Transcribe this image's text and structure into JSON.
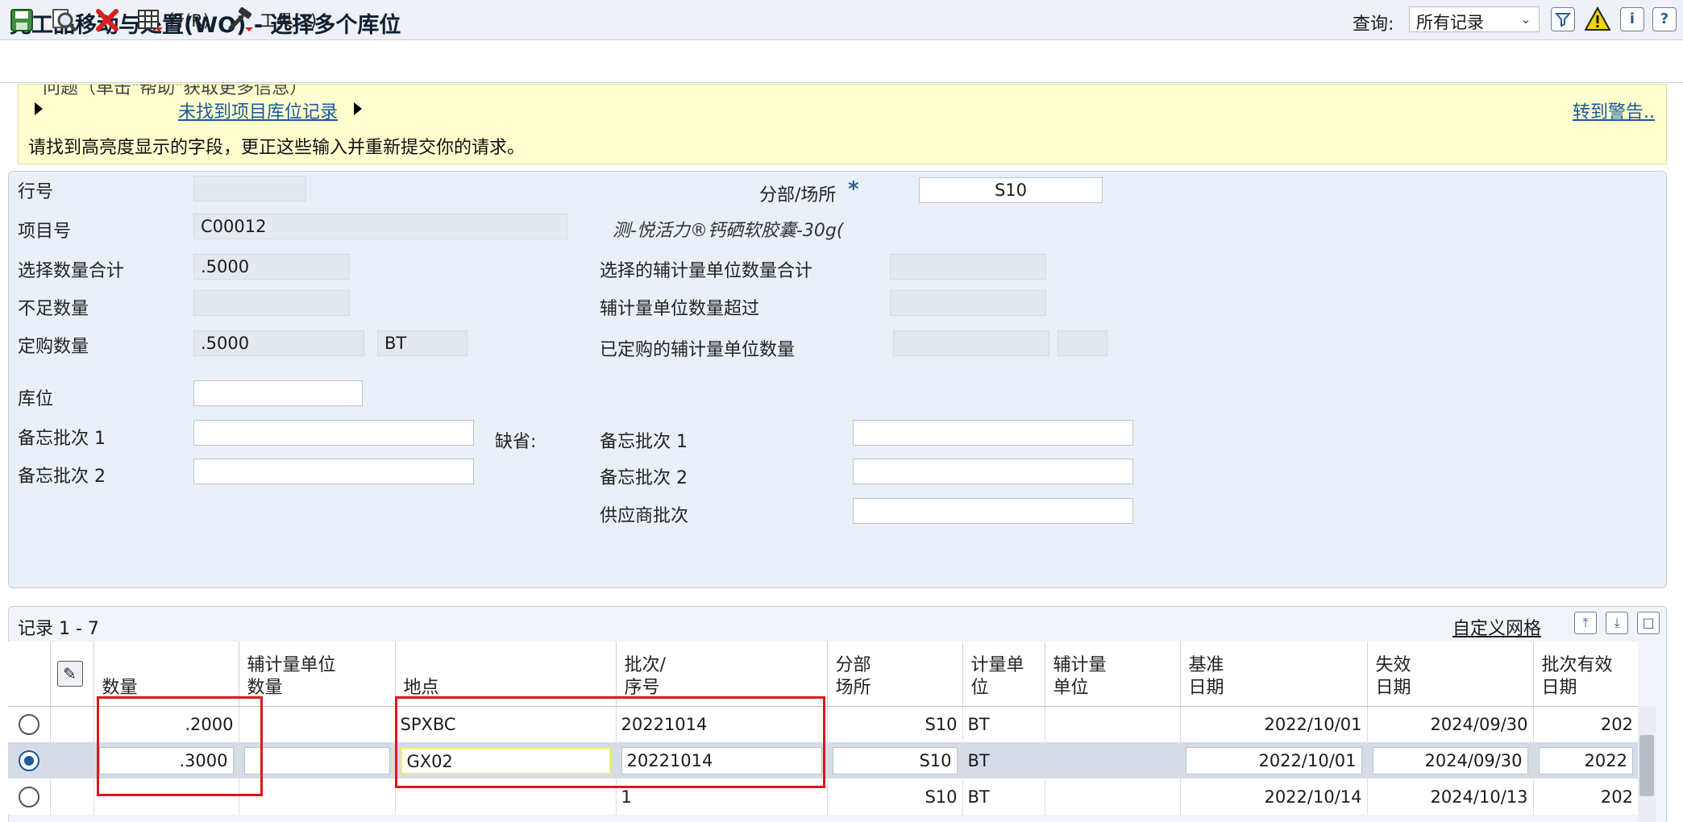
{
  "header": {
    "title": "完工品移动与处置(WO) - 选择多个库位",
    "query_label": "查询:",
    "query_value": "所有记录"
  },
  "toolbar": {
    "row_label": "行(R)",
    "tools_label": "工具(T)"
  },
  "banner": {
    "cut_text": "问题（单击\"帮助\"获取更多信息）",
    "error_link": "未找到项目库位记录",
    "goto_warnings": "转到警告..",
    "message": "请找到高亮度显示的字段，更正这些输入并重新提交你的请求。"
  },
  "form": {
    "line_no_label": "行号",
    "line_no_value": "",
    "branch_label": "分部/场所",
    "branch_value": "S10",
    "item_label": "项目号",
    "item_value": "C00012",
    "item_desc": "测-悦活力®钙硒软胶囊-30g(",
    "sel_qty_label": "选择数量合计",
    "sel_qty_value": ".5000",
    "sel_sec_label": "选择的辅计量单位数量合计",
    "sel_sec_value": "",
    "short_qty_label": "不足数量",
    "short_qty_value": "",
    "sec_over_label": "辅计量单位数量超过",
    "sec_over_value": "",
    "order_qty_label": "定购数量",
    "order_qty_value": ".5000",
    "order_uom_value": "BT",
    "ordered_sec_label": "已定购的辅计量单位数量",
    "location_label": "库位",
    "location_value": "",
    "memo1_label": "备忘批次 1",
    "memo2_label": "备忘批次 2",
    "default_label": "缺省:",
    "def_memo1_label": "备忘批次 1",
    "def_memo2_label": "备忘批次 2",
    "supplier_lot_label": "供应商批次"
  },
  "grid": {
    "record_count": "记录 1 - 7",
    "custom_grid": "自定义网格",
    "columns": [
      {
        "line1": "",
        "line2": "数量"
      },
      {
        "line1": "辅计量单位",
        "line2": "数量"
      },
      {
        "line1": "",
        "line2": "地点"
      },
      {
        "line1": "批次/",
        "line2": "序号"
      },
      {
        "line1": "分部",
        "line2": "场所"
      },
      {
        "line1": "计量单",
        "line2": "位"
      },
      {
        "line1": "辅计量",
        "line2": "单位"
      },
      {
        "line1": "基准",
        "line2": "日期"
      },
      {
        "line1": "失效",
        "line2": "日期"
      },
      {
        "line1": "批次有效",
        "line2": "日期"
      }
    ],
    "rows": [
      {
        "qty": ".2000",
        "sec_qty": "",
        "location": "SPXBC",
        "lot": "20221014",
        "branch": "S10",
        "uom": "BT",
        "sec_uom": "",
        "base_date": "2022/10/01",
        "exp_date": "2024/09/30",
        "lot_eff": "202"
      },
      {
        "qty": ".3000",
        "sec_qty": "",
        "location": "GX02",
        "lot": "20221014",
        "branch": "S10",
        "uom": "BT",
        "sec_uom": "",
        "base_date": "2022/10/01",
        "exp_date": "2024/09/30",
        "lot_eff": "2022"
      },
      {
        "qty": "",
        "sec_qty": "",
        "location": "",
        "lot": "1",
        "branch": "S10",
        "uom": "BT",
        "sec_uom": "",
        "base_date": "2022/10/14",
        "exp_date": "2024/10/13",
        "lot_eff": "202"
      }
    ]
  },
  "colors": {
    "banner_bg": "#ffffcf",
    "panel_bg": "#eaf0f8",
    "selected_row": "#d6dce7",
    "link": "#1a5a9b",
    "annotation_red": "#e0161b"
  }
}
